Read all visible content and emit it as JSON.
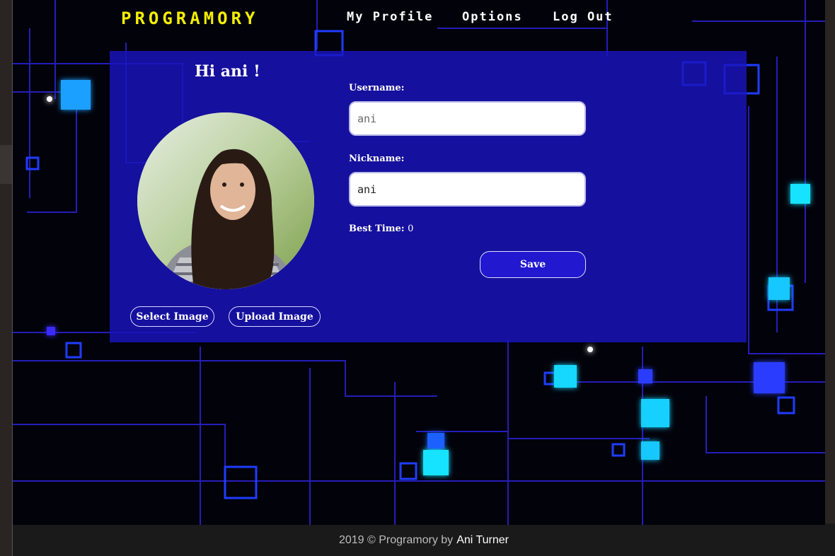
{
  "nav": {
    "logo": "PROGRAMORY",
    "items": [
      "My Profile",
      "Options",
      "Log Out"
    ]
  },
  "profile": {
    "greeting": "Hi ani !",
    "select_image_label": "Select Image",
    "upload_image_label": "Upload Image",
    "username_label": "Username:",
    "username_placeholder": "ani",
    "nickname_label": "Nickname:",
    "nickname_value": "ani",
    "best_time_label": "Best Time:",
    "best_time_value": "0",
    "save_label": "Save"
  },
  "footer": {
    "text": "2019 © Programory by",
    "author": "Ani Turner"
  },
  "colors": {
    "logo": "#f4ee00",
    "panel": "#1a14be",
    "save_button": "#2218d0",
    "circuit_glow": "#19e3ff",
    "circuit_line": "#2a22d8"
  },
  "icons": [
    "user-avatar-photo"
  ]
}
